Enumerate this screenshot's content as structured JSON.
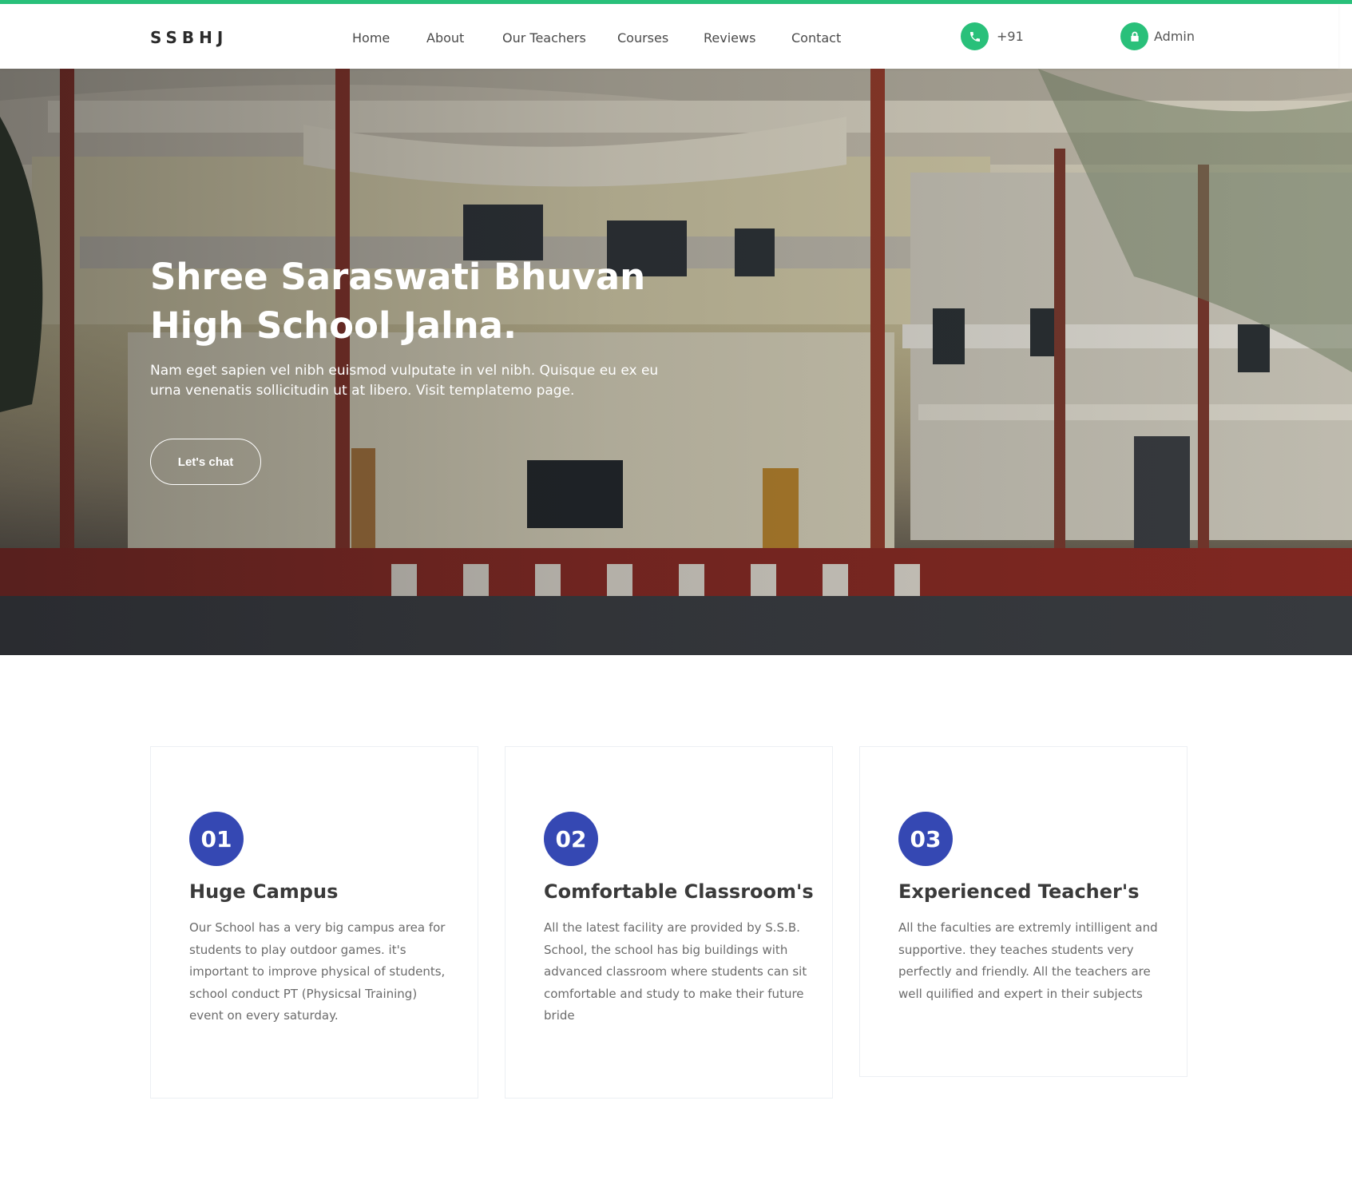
{
  "header": {
    "brand": "SSBHJ",
    "nav": [
      {
        "label": "Home"
      },
      {
        "label": "About"
      },
      {
        "label": "Our Teachers"
      },
      {
        "label": "Courses"
      },
      {
        "label": "Reviews"
      },
      {
        "label": "Contact"
      }
    ],
    "phone": {
      "label": "+91",
      "icon": "phone-icon"
    },
    "admin": {
      "label": "Admin",
      "icon": "lock-icon"
    }
  },
  "hero": {
    "title_line1": "Shree Saraswati Bhuvan",
    "title_line2": "High School Jalna.",
    "description": "Nam eget sapien vel nibh euismod vulputate in vel nibh. Quisque eu ex eu urna venenatis sollicitudin ut at libero. Visit templatemo page.",
    "button_label": "Let's chat"
  },
  "features": [
    {
      "number": "01",
      "title": "Huge Campus",
      "text": "Our School has a very big campus area for students to play outdoor games. it's important to improve physical of students, school conduct PT (Physicsal Training) event on every saturday."
    },
    {
      "number": "02",
      "title": "Comfortable Classroom's",
      "text": "All the latest facility are provided by S.S.B. School, the school has big buildings with advanced classroom where students can sit comfortable and study to make their future bride"
    },
    {
      "number": "03",
      "title": "Experienced Teacher's",
      "text": "All the faculties are extremly intilligent and supportive. they teaches students very perfectly and friendly. All the teachers are well quilified and expert in their subjects"
    }
  ],
  "colors": {
    "accent_green": "#29c07a",
    "badge_blue": "#3548b3"
  }
}
